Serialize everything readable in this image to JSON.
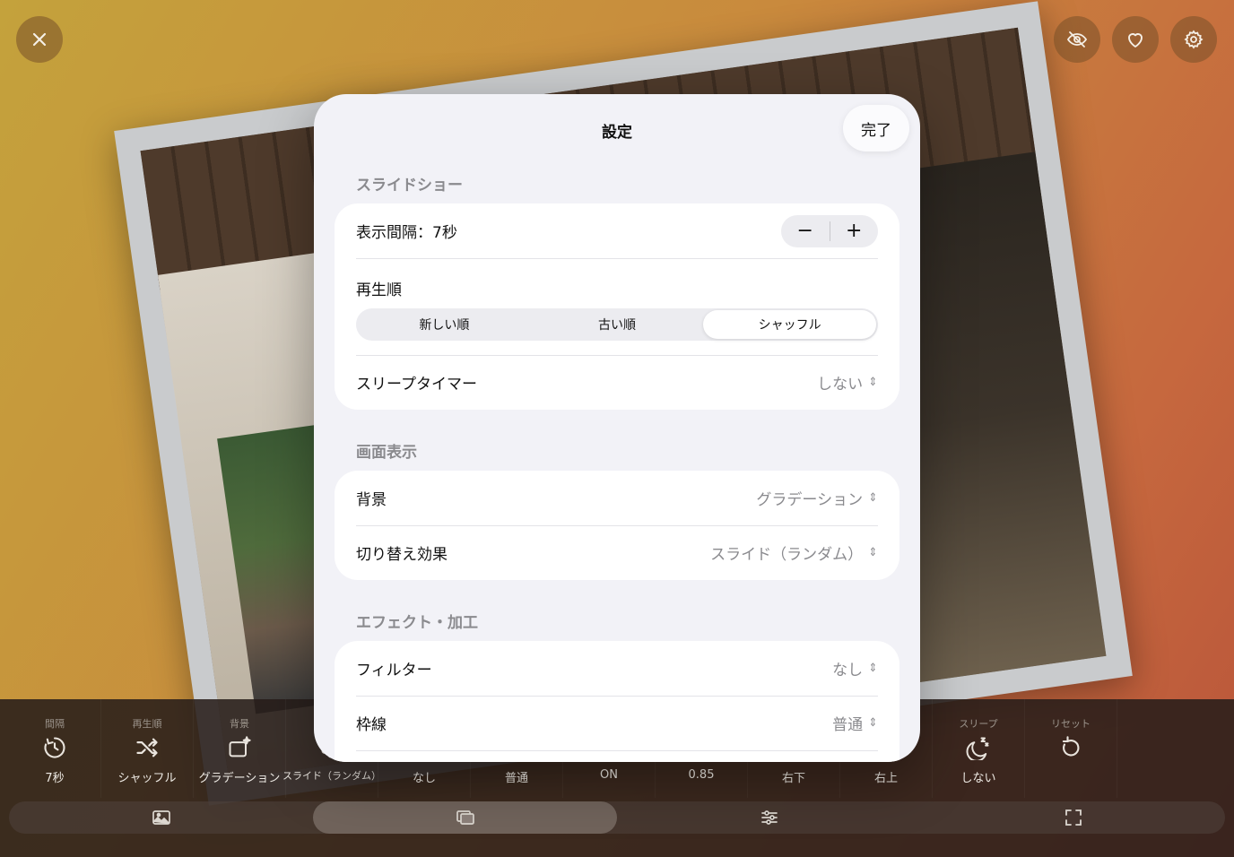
{
  "top_buttons": {
    "close_icon": "close-icon",
    "hide_icon": "eye-slash-icon",
    "favorite_icon": "heart-icon",
    "settings_icon": "gear-icon"
  },
  "modal": {
    "title": "設定",
    "done_label": "完了",
    "sections": {
      "slideshow": {
        "header": "スライドショー",
        "interval_label": "表示間隔：7秒",
        "stepper_minus": "−",
        "stepper_plus": "+",
        "order_label": "再生順",
        "order_options": [
          "新しい順",
          "古い順",
          "シャッフル"
        ],
        "order_selected": "シャッフル",
        "sleep_label": "スリープタイマー",
        "sleep_value": "しない"
      },
      "display": {
        "header": "画面表示",
        "background_label": "背景",
        "background_value": "グラデーション",
        "transition_label": "切り替え効果",
        "transition_value": "スライド（ランダム）"
      },
      "effects": {
        "header": "エフェクト・加工",
        "filter_label": "フィルター",
        "filter_value": "なし",
        "border_label": "枠線",
        "border_value": "普通"
      }
    }
  },
  "toolbar": {
    "items": [
      {
        "label": "間隔",
        "value": "7秒",
        "icon": "timer-icon"
      },
      {
        "label": "再生順",
        "value": "シャッフル",
        "icon": "shuffle-icon"
      },
      {
        "label": "背景",
        "value": "グラデーション",
        "icon": "background-sparkle-icon"
      },
      {
        "label": "",
        "value": "スライド（ランダム）",
        "icon": "transition-icon"
      },
      {
        "label": "",
        "value": "なし",
        "icon": ""
      },
      {
        "label": "",
        "value": "普通",
        "icon": ""
      },
      {
        "label": "",
        "value": "ON",
        "icon": ""
      },
      {
        "label": "",
        "value": "0.85",
        "icon": ""
      },
      {
        "label": "",
        "value": "右下",
        "icon": ""
      },
      {
        "label": "",
        "value": "右上",
        "icon": ""
      },
      {
        "label": "スリープ",
        "value": "しない",
        "icon": "sleep-moon-icon"
      },
      {
        "label": "リセット",
        "value": "",
        "icon": "reset-icon"
      }
    ]
  },
  "tabs": [
    {
      "icon": "photo-icon",
      "active": false
    },
    {
      "icon": "slides-icon",
      "active": true
    },
    {
      "icon": "sliders-icon",
      "active": false
    },
    {
      "icon": "fullscreen-icon",
      "active": false
    }
  ]
}
